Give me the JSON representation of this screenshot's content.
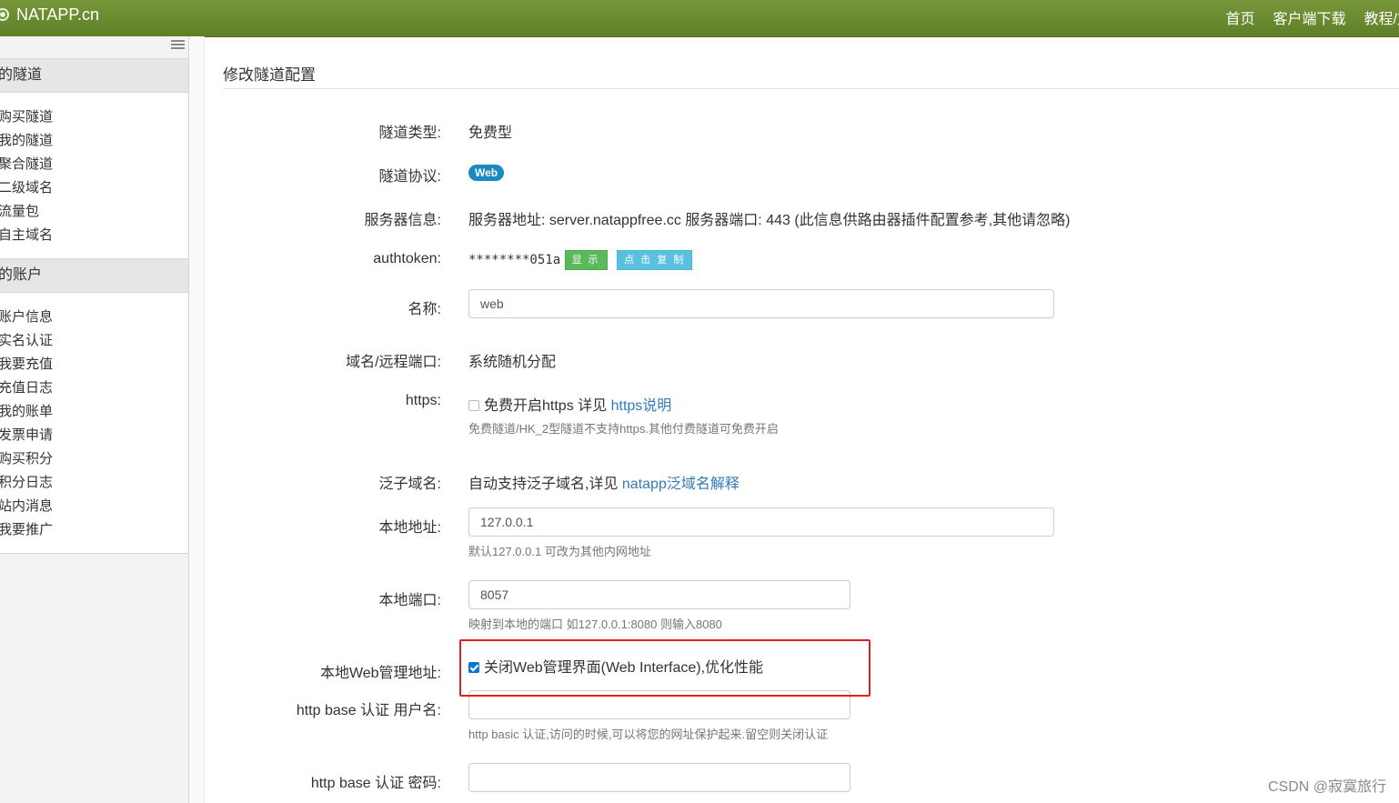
{
  "topbar": {
    "brand": "NATAPP.cn",
    "nav": [
      "首页",
      "客户端下载",
      "教程/文"
    ]
  },
  "sidebar": {
    "groups": [
      {
        "title": "的隧道",
        "items": [
          "购买隧道",
          "我的隧道",
          "聚合隧道",
          "二级域名",
          "流量包",
          "自主域名"
        ]
      },
      {
        "title": "的账户",
        "items": [
          "账户信息",
          "实名认证",
          "我要充值",
          "充值日志",
          "我的账单",
          "发票申请",
          "购买积分",
          "积分日志",
          "站内消息",
          "我要推广"
        ]
      }
    ]
  },
  "page": {
    "title": "修改隧道配置"
  },
  "form": {
    "tunnel_type": {
      "label": "隧道类型:",
      "value": "免费型"
    },
    "protocol": {
      "label": "隧道协议:",
      "badge": "Web"
    },
    "server_info": {
      "label": "服务器信息:",
      "value": "服务器地址: server.natappfree.cc 服务器端口: 443 (此信息供路由器插件配置参考,其他请忽略)"
    },
    "authtoken": {
      "label": "authtoken:",
      "value": "********051a",
      "show_button": "显 示",
      "copy_button": "点 击 复 制"
    },
    "name": {
      "label": "名称:",
      "value": "web"
    },
    "domain_port": {
      "label": "域名/远程端口:",
      "value": "系统随机分配"
    },
    "https": {
      "label": "https:",
      "checkbox_text": "免费开启https 详见 ",
      "link": "https说明",
      "help": "免费隧道/HK_2型隧道不支持https.其他付费隧道可免费开启"
    },
    "wildcard": {
      "label": "泛子域名:",
      "text": "自动支持泛子域名,详见 ",
      "link": "natapp泛域名解释"
    },
    "local_addr": {
      "label": "本地地址:",
      "value": "127.0.0.1",
      "help": "默认127.0.0.1 可改为其他内网地址"
    },
    "local_port": {
      "label": "本地端口:",
      "value": "8057",
      "help": "映射到本地的端口 如127.0.0.1:8080 则输入8080"
    },
    "web_admin": {
      "label": "本地Web管理地址:",
      "checkbox_text": "关闭Web管理界面(Web Interface),优化性能",
      "checked": true
    },
    "basic_user": {
      "label": "http base 认证 用户名:",
      "value": "",
      "help": "http basic 认证,访问的时候,可以将您的网址保护起来.留空则关闭认证"
    },
    "basic_pass": {
      "label": "http base 认证 密码:",
      "value": ""
    }
  },
  "colors": {
    "topbar": "#6c8a2e",
    "badge": "#1a8bc2",
    "link": "#337ab7",
    "highlight_box": "#e02020"
  },
  "watermark": "CSDN @寂寞旅行"
}
